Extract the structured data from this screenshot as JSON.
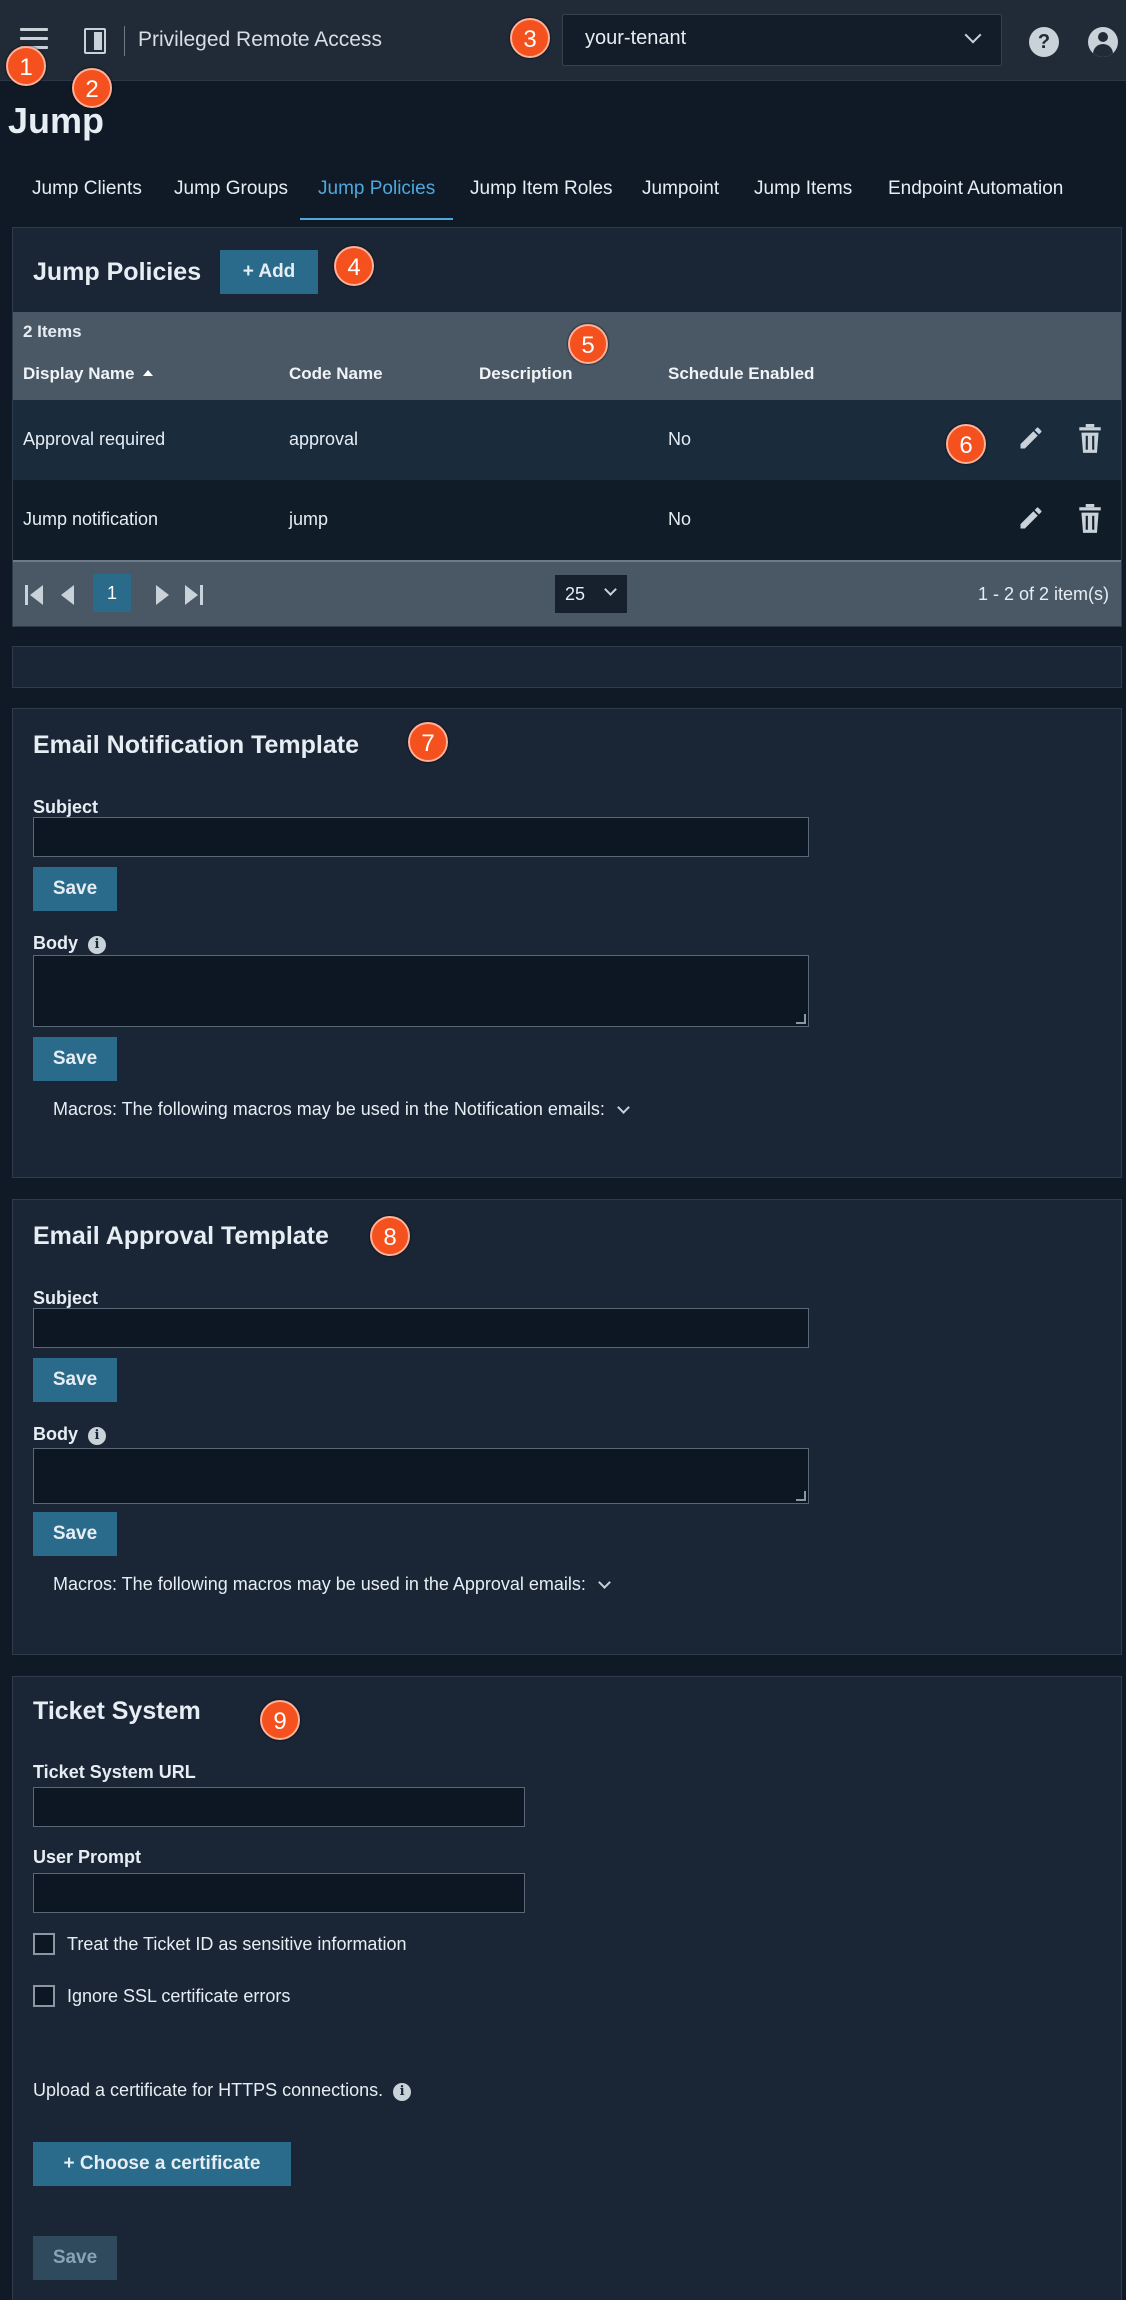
{
  "header": {
    "product_name": "Privileged Remote Access",
    "tenant_value": "your-tenant",
    "help_glyph": "?"
  },
  "page": {
    "title": "Jump"
  },
  "tabs": [
    {
      "label": "Jump Clients",
      "active": false
    },
    {
      "label": "Jump Groups",
      "active": false
    },
    {
      "label": "Jump Policies",
      "active": true
    },
    {
      "label": "Jump Item Roles",
      "active": false
    },
    {
      "label": "Jumpoint",
      "active": false
    },
    {
      "label": "Jump Items",
      "active": false
    },
    {
      "label": "Endpoint Automation",
      "active": false
    }
  ],
  "jump_policies": {
    "title": "Jump Policies",
    "add_label": "+ Add",
    "items_count": "2 Items",
    "columns": [
      "Display Name",
      "Code Name",
      "Description",
      "Schedule Enabled"
    ],
    "rows": [
      {
        "display_name": "Approval required",
        "code_name": "approval",
        "description": "",
        "schedule_enabled": "No"
      },
      {
        "display_name": "Jump notification",
        "code_name": "jump",
        "description": "",
        "schedule_enabled": "No"
      }
    ],
    "pager": {
      "current_page": "1",
      "page_size": "25",
      "info": "1 - 2 of 2 item(s)"
    }
  },
  "email_notification": {
    "title": "Email Notification Template",
    "subject_label": "Subject",
    "subject_value": "",
    "save_label": "Save",
    "body_label": "Body",
    "body_value": "",
    "macros_text": "Macros: The following macros may be used in the Notification emails:"
  },
  "email_approval": {
    "title": "Email Approval Template",
    "subject_label": "Subject",
    "subject_value": "",
    "save_label": "Save",
    "body_label": "Body",
    "body_value": "",
    "macros_text": "Macros: The following macros may be used in the Approval emails:"
  },
  "ticket_system": {
    "title": "Ticket System",
    "url_label": "Ticket System URL",
    "url_value": "",
    "prompt_label": "User Prompt",
    "prompt_value": "",
    "sensitive_label": "Treat the Ticket ID as sensitive information",
    "sensitive_checked": false,
    "ssl_label": "Ignore SSL certificate errors",
    "ssl_checked": false,
    "upload_text": "Upload a certificate for HTTPS connections.",
    "choose_label": "+ Choose a certificate",
    "save_label": "Save"
  },
  "info_glyph": "i",
  "callouts": [
    "1",
    "2",
    "3",
    "4",
    "5",
    "6",
    "7",
    "8",
    "9"
  ],
  "colors": {
    "accent": "#4ea8de",
    "button": "#2a6a8a",
    "callout": "#f4511e"
  }
}
